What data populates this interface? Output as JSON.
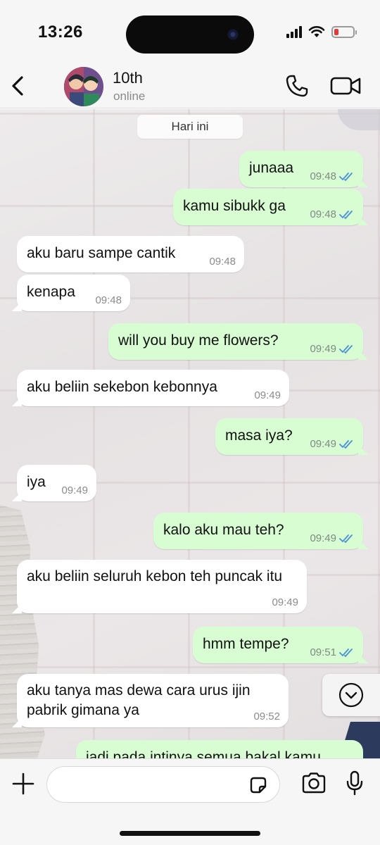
{
  "status_bar": {
    "time": "13:26"
  },
  "header": {
    "contact_name": "10th",
    "contact_status": "online"
  },
  "chat": {
    "date_label": "Hari ini",
    "messages": [
      {
        "direction": "out",
        "text": "junaaa",
        "time": "09:48",
        "read": true
      },
      {
        "direction": "out",
        "text": "kamu sibukk ga",
        "time": "09:48",
        "read": true
      },
      {
        "direction": "in",
        "text": "aku baru sampe cantik",
        "time": "09:48"
      },
      {
        "direction": "in",
        "text": "kenapa",
        "time": "09:48"
      },
      {
        "direction": "out",
        "text": "will you buy me flowers?",
        "time": "09:49",
        "read": true
      },
      {
        "direction": "in",
        "text": "aku beliin sekebon kebonnya",
        "time": "09:49"
      },
      {
        "direction": "out",
        "text": "masa iya?",
        "time": "09:49",
        "read": true
      },
      {
        "direction": "in",
        "text": "iya",
        "time": "09:49"
      },
      {
        "direction": "out",
        "text": "kalo aku mau teh?",
        "time": "09:49",
        "read": true
      },
      {
        "direction": "in",
        "text": "aku beliin seluruh kebon teh puncak itu",
        "time": "09:49"
      },
      {
        "direction": "out",
        "text": "hmm tempe?",
        "time": "09:51",
        "read": true
      },
      {
        "direction": "in",
        "text": "aku tanya mas dewa cara urus ijin pabrik gimana ya",
        "time": "09:52"
      },
      {
        "direction": "out",
        "text": "jadi pada intinya semua bakal kamu",
        "time": ""
      }
    ]
  },
  "colors": {
    "outgoing_bubble": "#d9fdd3",
    "incoming_bubble": "#ffffff",
    "read_ticks": "#4a90d9"
  },
  "icons": {
    "back": "chevron-left-icon",
    "call": "phone-icon",
    "video": "video-camera-icon",
    "scroll": "chevron-down-circle-icon",
    "attach": "plus-icon",
    "sticker": "sticker-icon",
    "camera": "camera-icon",
    "mic": "microphone-icon"
  }
}
